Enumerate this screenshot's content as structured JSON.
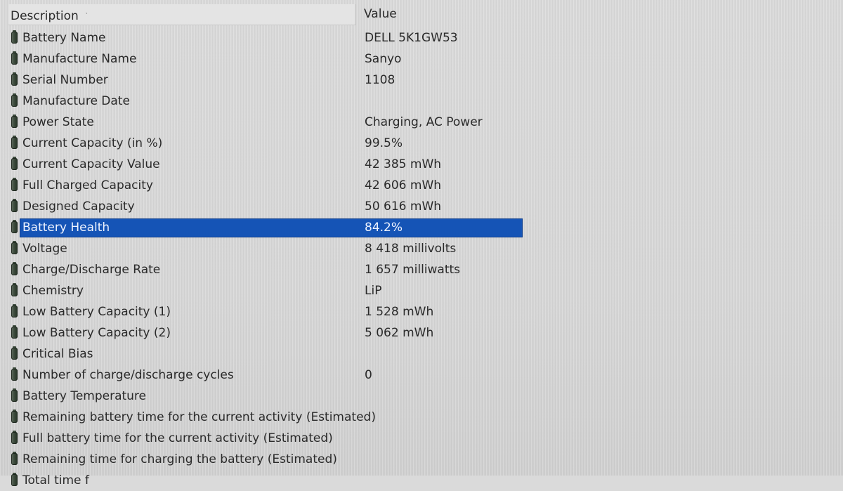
{
  "table": {
    "header": {
      "description": "Description",
      "value": "Value"
    },
    "rows": [
      {
        "label": "Battery Name",
        "value": "DELL 5K1GW53"
      },
      {
        "label": "Manufacture Name",
        "value": "Sanyo"
      },
      {
        "label": "Serial Number",
        "value": "1108"
      },
      {
        "label": "Manufacture Date",
        "value": ""
      },
      {
        "label": "Power State",
        "value": "Charging, AC Power"
      },
      {
        "label": "Current Capacity (in %)",
        "value": "99.5%"
      },
      {
        "label": "Current Capacity Value",
        "value": "42 385 mWh"
      },
      {
        "label": "Full Charged Capacity",
        "value": "42 606 mWh"
      },
      {
        "label": "Designed Capacity",
        "value": "50 616 mWh"
      },
      {
        "label": "Battery Health",
        "value": "84.2%",
        "selected": true
      },
      {
        "label": "Voltage",
        "value": "8 418 millivolts"
      },
      {
        "label": "Charge/Discharge Rate",
        "value": "1 657 milliwatts"
      },
      {
        "label": "Chemistry",
        "value": "LiP"
      },
      {
        "label": "Low Battery Capacity (1)",
        "value": "1 528 mWh"
      },
      {
        "label": "Low Battery Capacity (2)",
        "value": "5 062 mWh"
      },
      {
        "label": "Critical Bias",
        "value": ""
      },
      {
        "label": "Number of charge/discharge cycles",
        "value": "0"
      },
      {
        "label": "Battery Temperature",
        "value": ""
      },
      {
        "label": "Remaining battery time for the current activity (Estimated)",
        "value": ""
      },
      {
        "label": "Full battery time for the current activity (Estimated)",
        "value": ""
      },
      {
        "label": "Remaining time for charging the battery (Estimated)",
        "value": ""
      },
      {
        "label": "Total time f",
        "value": ""
      }
    ],
    "row_icon": "battery-icon",
    "selection_color": "#1554b6"
  }
}
